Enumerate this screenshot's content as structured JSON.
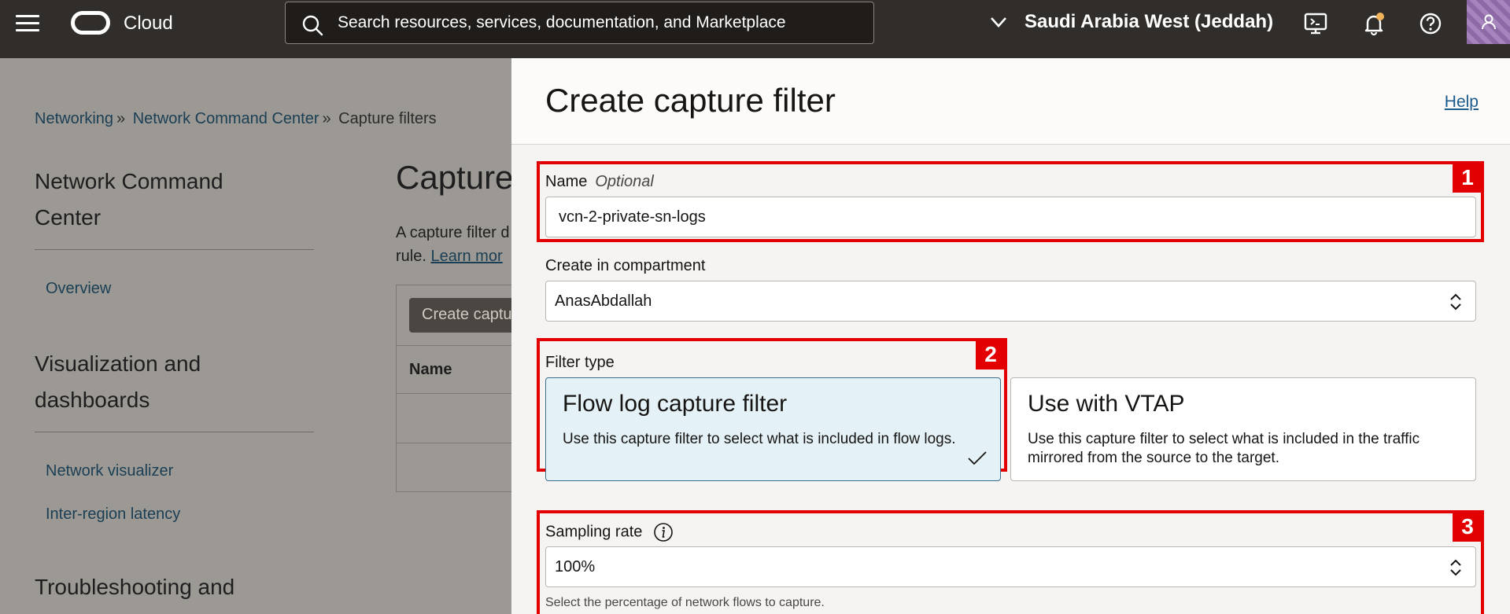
{
  "topbar": {
    "brand": "Cloud",
    "search_placeholder": "Search resources, services, documentation, and Marketplace",
    "region": "Saudi Arabia West (Jeddah)"
  },
  "background": {
    "breadcrumb": [
      "Networking",
      "Network Command Center",
      "Capture filters"
    ],
    "sidebar": {
      "sections": [
        {
          "heading": "Network Command Center",
          "links": [
            "Overview"
          ]
        },
        {
          "heading": "Visualization and dashboards",
          "links": [
            "Network visualizer",
            "Inter-region latency"
          ]
        },
        {
          "heading": "Troubleshooting and"
        }
      ]
    },
    "main_title": "Capture",
    "intro_line1": "A capture filter d",
    "intro_line2_prefix": "rule. ",
    "learn_more": "Learn mor",
    "create_button": "Create captu",
    "table_header_name": "Name"
  },
  "panel": {
    "title": "Create capture filter",
    "help_link": "Help",
    "name_field": {
      "label": "Name",
      "optional": "Optional",
      "value": "vcn-2-private-sn-logs"
    },
    "compartment_field": {
      "label": "Create in compartment",
      "value": "AnasAbdallah"
    },
    "filter_type": {
      "label": "Filter type",
      "options": [
        {
          "title": "Flow log capture filter",
          "description": "Use this capture filter to select what is included in flow logs.",
          "selected": true
        },
        {
          "title": "Use with VTAP",
          "description": "Use this capture filter to select what is included in the traffic mirrored from the source to the target.",
          "selected": false
        }
      ]
    },
    "sampling_rate": {
      "label": "Sampling rate",
      "value": "100%",
      "help": "Select the percentage of network flows to capture."
    },
    "callouts": [
      "1",
      "2",
      "3"
    ]
  },
  "colors": {
    "highlight": "#e30000",
    "topbar": "#312d2a",
    "selected_card": "#e4f1f6",
    "link": "#1a5b8c"
  }
}
